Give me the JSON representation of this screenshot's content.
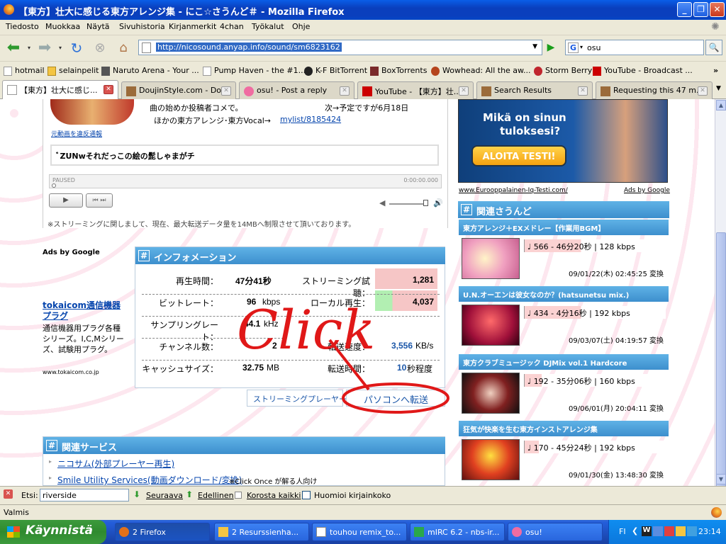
{
  "window": {
    "title": "【東方】壮大に感じる東方アレンジ集 - にこ☆さうんど＃ - Mozilla Firefox"
  },
  "menu": [
    "Tiedosto",
    "Muokkaa",
    "Näytä",
    "Sivuhistoria",
    "Kirjanmerkit",
    "4chan",
    "Työkalut",
    "Ohje"
  ],
  "nav": {
    "url": "http://nicosound.anyap.info/sound/sm6823162",
    "search_engine": "G",
    "search_value": "osu"
  },
  "bookmarks": [
    "hotmail",
    "selainpelit",
    "Naruto Arena - Your ...",
    "Pump Haven - the #1...",
    "K-F BitTorrent",
    "BoxTorrents",
    "Wowhead: All the aw...",
    "Storm Berry",
    "YouTube - Broadcast ..."
  ],
  "tabs": [
    "【東方】壮大に感じ...",
    "DoujinStyle.com - Do...",
    "osu! - Post a reply",
    "YouTube - 【東方】壮...",
    "Search Results",
    "Requesting this 47 m..."
  ],
  "page": {
    "desc1": "曲の始めか投稿者コメで。",
    "desc2": "次→予定ですが6月18日",
    "desc3": "ほかの東方アレンジ･東方Vocal→",
    "mylist": "mylist/8185424",
    "report": "元動画を違反通報",
    "comment": "ﾞZUNwそれだっこの絵の髭しゃまがチ",
    "player_state": "PAUSED",
    "player_time": "0:00:00.000",
    "stream_note": "※ストリーミングに関しまして、現在、最大転送データ量を14MBへ制限させて頂いております。",
    "ads_by": "Ads by Google",
    "ad_title": "tokaicom通信機器プラグ",
    "ad_body": "通信機器用プラグ各種シリーズ。I,C,Mシリーズ、試験用プラグ。",
    "ad_url": "www.tokaicom.co.jp",
    "info_header": "インフォメーション",
    "info": [
      {
        "label": "再生時間：",
        "value": "47分41秒",
        "label2": "ストリーミング試聴：",
        "value2": "1,281"
      },
      {
        "label": "ビットレート：",
        "value": "96",
        "unit": "kbps",
        "label2": "ローカル再生：",
        "value2": "4,037"
      },
      {
        "label": "サンプリングレート：",
        "value": "44.1",
        "unit": "kHz",
        "label2": "",
        "value2": ""
      },
      {
        "label": "チャンネル数：",
        "value": "2",
        "label2": "転送速度：",
        "value2": "3,556",
        "unit2": "KB/s"
      },
      {
        "label": "キャッシュサイズ：",
        "value": "32.75",
        "unit": "MB",
        "label2": "転送時間：",
        "value2": "10",
        "unit2": "秒程度"
      }
    ],
    "stream_player_btn": "ストリーミングプレーヤー※",
    "transfer_btn": "パソコンへ転送",
    "click_annotation": "Click",
    "services_header": "関連サービス",
    "service1": "ニコサム(外部プレーヤー再生)",
    "service2": "Smile Utility Services(動画ダウンロード/変換)",
    "service2_note": "※Click Once が解る人向け",
    "ad_right_text1": "Mikä on sinun",
    "ad_right_text2": "tuloksesi?",
    "ad_right_btn": "ALOITA TESTI!",
    "ad_right_url": "www.Eurooppalainen-Iq-Testi.com/",
    "ad_right_by": "Ads by Google",
    "related_header": "関連さうんど",
    "related": [
      {
        "title": "東方アレンジ＋EXメドレー【作業用BGM】",
        "stats": "566 - 46分20秒 | 128 kbps",
        "date": "09/01/22(木) 02:45:25 変換"
      },
      {
        "title": "U.N.オーエンは彼女なのか？(hatsunetsu mix.)",
        "stats": "434 - 4分16秒 | 192 kbps",
        "date": "09/03/07(土) 04:19:57 変換"
      },
      {
        "title": "東方クラブミュージック DJMix vol.1 Hardcore",
        "stats": "192 - 35分06秒 | 160 kbps",
        "date": "09/06/01(月) 20:04:11 変換"
      },
      {
        "title": "狂気が快楽を生む東方インストアレンジ集",
        "stats": "170 - 45分24秒 | 192 kbps",
        "date": "09/01/30(金) 13:48:30 変換"
      }
    ]
  },
  "findbar": {
    "label": "Etsi:",
    "value": "riverside",
    "next": "Seuraava",
    "prev": "Edellinen",
    "highlight": "Korosta kaikki",
    "matchcase": "Huomioi kirjainkoko"
  },
  "status": "Valmis",
  "taskbar": {
    "start": "Käynnistä",
    "items": [
      "2 Firefox",
      "2 Resurssienha...",
      "touhou remix_to...",
      "mIRC 6.2 - nbs-ir...",
      "osu!"
    ],
    "lang": "FI",
    "time": "23:14"
  }
}
